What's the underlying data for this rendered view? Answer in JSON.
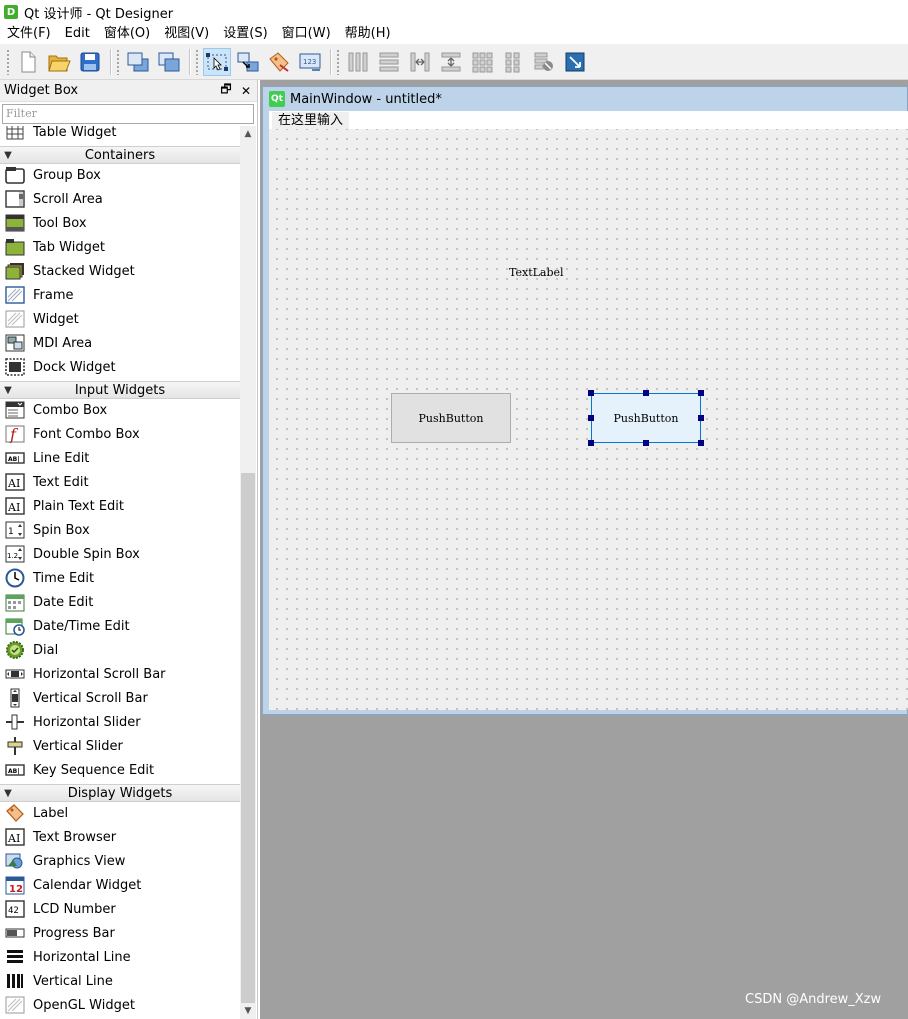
{
  "window": {
    "title": "Qt 设计师 - Qt Designer",
    "icon": "designer-app-icon"
  },
  "menubar": {
    "items": [
      "文件(F)",
      "Edit",
      "窗体(O)",
      "视图(V)",
      "设置(S)",
      "窗口(W)",
      "帮助(H)"
    ]
  },
  "toolbar": {
    "groups": [
      [
        "new-file-icon",
        "open-file-icon",
        "save-icon"
      ],
      [
        "send-to-back-icon",
        "bring-to-front-icon"
      ],
      [
        "edit-widgets-icon",
        "edit-signals-slots-icon",
        "edit-buddies-icon",
        "edit-tab-order-icon"
      ],
      [
        "layout-horizontal-icon",
        "layout-vertical-icon",
        "layout-h-splitter-icon",
        "layout-v-splitter-icon",
        "layout-grid-icon",
        "layout-form-icon",
        "break-layout-icon",
        "adjust-size-icon"
      ]
    ]
  },
  "widget_box": {
    "title": "Widget Box",
    "filter_placeholder": "Filter",
    "list": [
      {
        "kind": "item",
        "label": "Table Widget",
        "icon": "table-widget-icon"
      },
      {
        "kind": "category",
        "label": "Containers"
      },
      {
        "kind": "item",
        "label": "Group Box",
        "icon": "group-box-icon"
      },
      {
        "kind": "item",
        "label": "Scroll Area",
        "icon": "scroll-area-icon"
      },
      {
        "kind": "item",
        "label": "Tool Box",
        "icon": "tool-box-icon"
      },
      {
        "kind": "item",
        "label": "Tab Widget",
        "icon": "tab-widget-icon"
      },
      {
        "kind": "item",
        "label": "Stacked Widget",
        "icon": "stacked-widget-icon"
      },
      {
        "kind": "item",
        "label": "Frame",
        "icon": "frame-icon"
      },
      {
        "kind": "item",
        "label": "Widget",
        "icon": "widget-icon"
      },
      {
        "kind": "item",
        "label": "MDI Area",
        "icon": "mdi-area-icon"
      },
      {
        "kind": "item",
        "label": "Dock Widget",
        "icon": "dock-widget-icon"
      },
      {
        "kind": "category",
        "label": "Input Widgets"
      },
      {
        "kind": "item",
        "label": "Combo Box",
        "icon": "combo-box-icon"
      },
      {
        "kind": "item",
        "label": "Font Combo Box",
        "icon": "font-combo-box-icon"
      },
      {
        "kind": "item",
        "label": "Line Edit",
        "icon": "line-edit-icon"
      },
      {
        "kind": "item",
        "label": "Text Edit",
        "icon": "text-edit-icon"
      },
      {
        "kind": "item",
        "label": "Plain Text Edit",
        "icon": "plain-text-edit-icon"
      },
      {
        "kind": "item",
        "label": "Spin Box",
        "icon": "spin-box-icon"
      },
      {
        "kind": "item",
        "label": "Double Spin Box",
        "icon": "double-spin-box-icon"
      },
      {
        "kind": "item",
        "label": "Time Edit",
        "icon": "time-edit-icon"
      },
      {
        "kind": "item",
        "label": "Date Edit",
        "icon": "date-edit-icon"
      },
      {
        "kind": "item",
        "label": "Date/Time Edit",
        "icon": "date-time-edit-icon"
      },
      {
        "kind": "item",
        "label": "Dial",
        "icon": "dial-icon"
      },
      {
        "kind": "item",
        "label": "Horizontal Scroll Bar",
        "icon": "horizontal-scroll-bar-icon"
      },
      {
        "kind": "item",
        "label": "Vertical Scroll Bar",
        "icon": "vertical-scroll-bar-icon"
      },
      {
        "kind": "item",
        "label": "Horizontal Slider",
        "icon": "horizontal-slider-icon"
      },
      {
        "kind": "item",
        "label": "Vertical Slider",
        "icon": "vertical-slider-icon"
      },
      {
        "kind": "item",
        "label": "Key Sequence Edit",
        "icon": "key-sequence-edit-icon"
      },
      {
        "kind": "category",
        "label": "Display Widgets"
      },
      {
        "kind": "item",
        "label": "Label",
        "icon": "label-icon"
      },
      {
        "kind": "item",
        "label": "Text Browser",
        "icon": "text-browser-icon"
      },
      {
        "kind": "item",
        "label": "Graphics View",
        "icon": "graphics-view-icon"
      },
      {
        "kind": "item",
        "label": "Calendar Widget",
        "icon": "calendar-widget-icon"
      },
      {
        "kind": "item",
        "label": "LCD Number",
        "icon": "lcd-number-icon"
      },
      {
        "kind": "item",
        "label": "Progress Bar",
        "icon": "progress-bar-icon"
      },
      {
        "kind": "item",
        "label": "Horizontal Line",
        "icon": "horizontal-line-icon"
      },
      {
        "kind": "item",
        "label": "Vertical Line",
        "icon": "vertical-line-icon"
      },
      {
        "kind": "item",
        "label": "OpenGL Widget",
        "icon": "opengl-widget-icon"
      }
    ]
  },
  "form_window": {
    "title": "MainWindow - untitled*",
    "menu_placeholder": "在这里输入",
    "text_label": "TextLabel",
    "push_button_1": "PushButton",
    "push_button_2": "PushButton"
  },
  "watermark": "CSDN @Andrew_Xzw"
}
